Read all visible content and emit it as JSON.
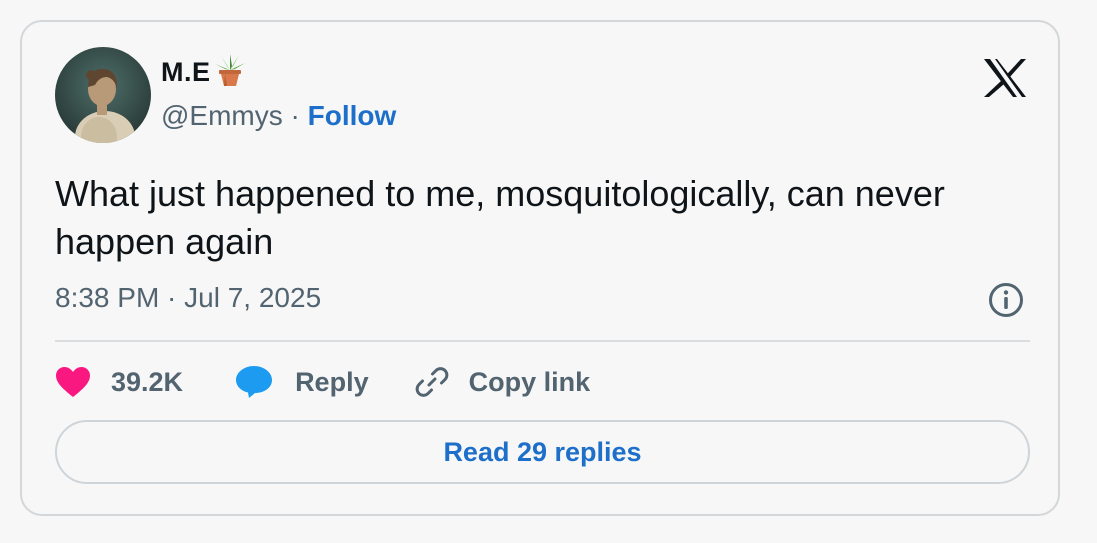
{
  "author": {
    "name": "M.E",
    "handle": "@Emmys",
    "separator": "·",
    "follow_label": "Follow",
    "name_emoji_icon": "potted-plant-icon"
  },
  "tweet": {
    "text": "What just happened to me, mosquitologically, can never happen again",
    "timestamp": "8:38 PM · Jul 7, 2025"
  },
  "actions": {
    "like_count": "39.2K",
    "reply_label": "Reply",
    "copy_link_label": "Copy link"
  },
  "read_replies_label": "Read 29 replies",
  "icons": {
    "brand": "x-logo-icon",
    "info": "info-icon",
    "like": "heart-icon",
    "reply": "speech-bubble-icon",
    "copy": "link-icon"
  },
  "colors": {
    "link_blue": "#1d6fc9",
    "heart_pink": "#f91880",
    "reply_blue": "#1d9bf0",
    "secondary_text": "#536471",
    "primary_text": "#0f1419"
  }
}
